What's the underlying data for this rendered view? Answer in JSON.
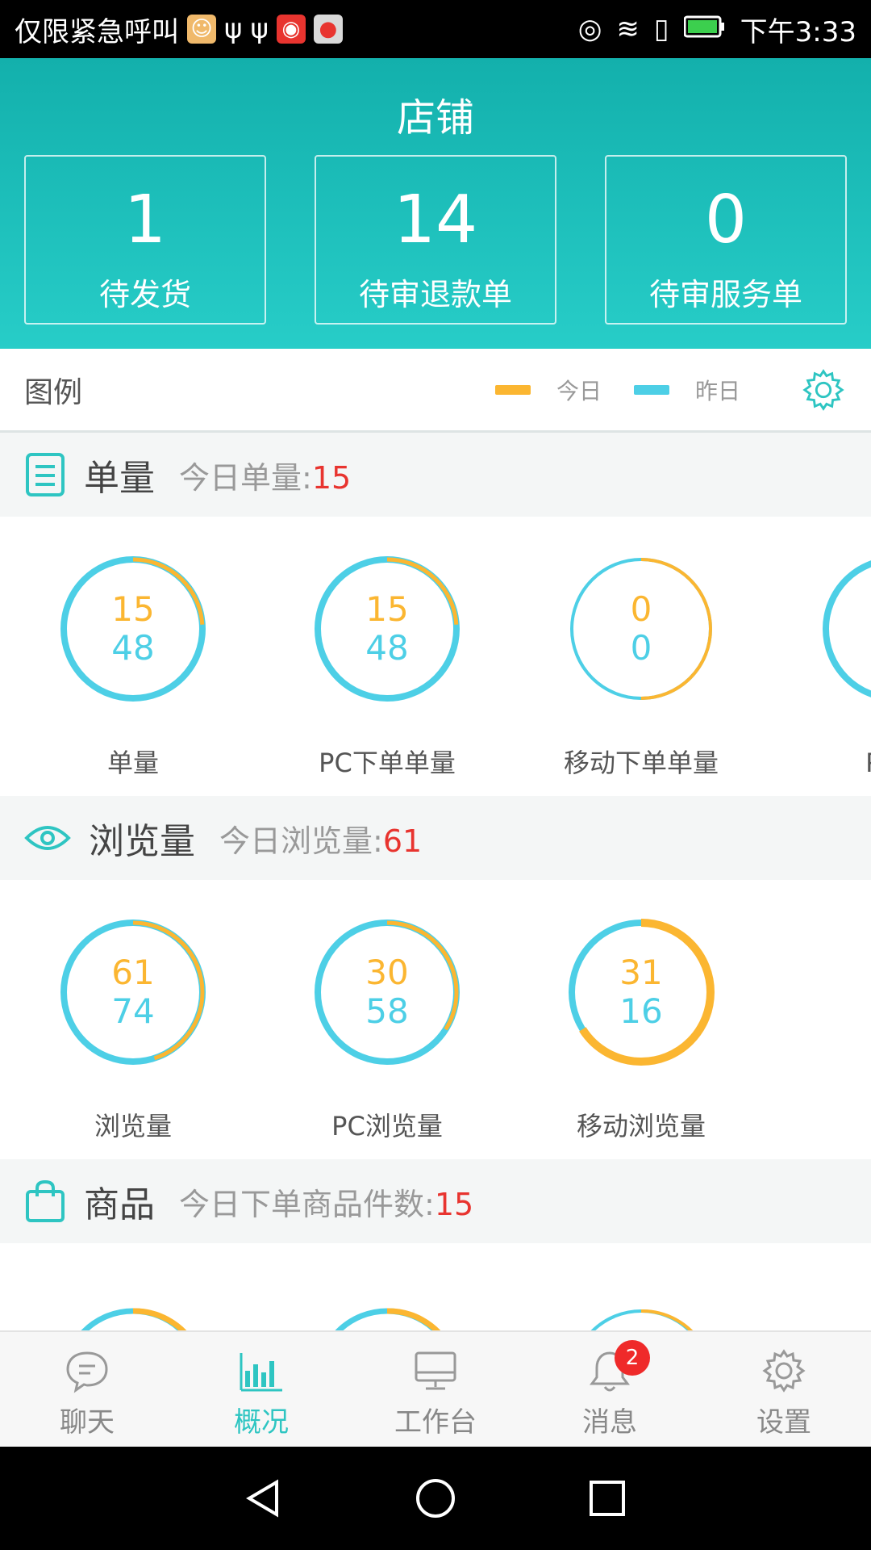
{
  "status_bar": {
    "carrier_text": "仅限紧急呼叫",
    "time": "下午3:33"
  },
  "header": {
    "title": "店铺",
    "stats": [
      {
        "value": "1",
        "label": "待发货"
      },
      {
        "value": "14",
        "label": "待审退款单"
      },
      {
        "value": "0",
        "label": "待审服务单"
      }
    ]
  },
  "legend": {
    "title": "图例",
    "today_label": "今日",
    "yesterday_label": "昨日",
    "today_color": "#fbb631",
    "yesterday_color": "#4dcfe6"
  },
  "sections": {
    "orders": {
      "title": "单量",
      "sub_label": "今日单量:",
      "sub_value": "15",
      "rings": [
        {
          "today": "15",
          "yesterday": "48",
          "label": "单量",
          "today_share": 0.24
        },
        {
          "today": "15",
          "yesterday": "48",
          "label": "PC下单单量",
          "today_share": 0.24
        },
        {
          "today": "0",
          "yesterday": "0",
          "label": "移动下单单量",
          "today_share": 0.5
        },
        {
          "today": "",
          "yesterday": "",
          "label": "PC下",
          "today_share": 0.24
        }
      ]
    },
    "views": {
      "title": "浏览量",
      "sub_label": "今日浏览量:",
      "sub_value": "61",
      "rings": [
        {
          "today": "61",
          "yesterday": "74",
          "label": "浏览量",
          "today_share": 0.45
        },
        {
          "today": "30",
          "yesterday": "58",
          "label": "PC浏览量",
          "today_share": 0.34
        },
        {
          "today": "31",
          "yesterday": "16",
          "label": "移动浏览量",
          "today_share": 0.66
        }
      ]
    },
    "goods": {
      "title": "商品",
      "sub_label": "今日下单商品件数:",
      "sub_value": "15"
    }
  },
  "bottom_nav": [
    {
      "label": "聊天",
      "icon": "chat-icon",
      "active": false
    },
    {
      "label": "概况",
      "icon": "bar-chart-icon",
      "active": true
    },
    {
      "label": "工作台",
      "icon": "monitor-icon",
      "active": false
    },
    {
      "label": "消息",
      "icon": "bell-icon",
      "active": false,
      "badge": "2"
    },
    {
      "label": "设置",
      "icon": "settings-icon",
      "active": false
    }
  ]
}
